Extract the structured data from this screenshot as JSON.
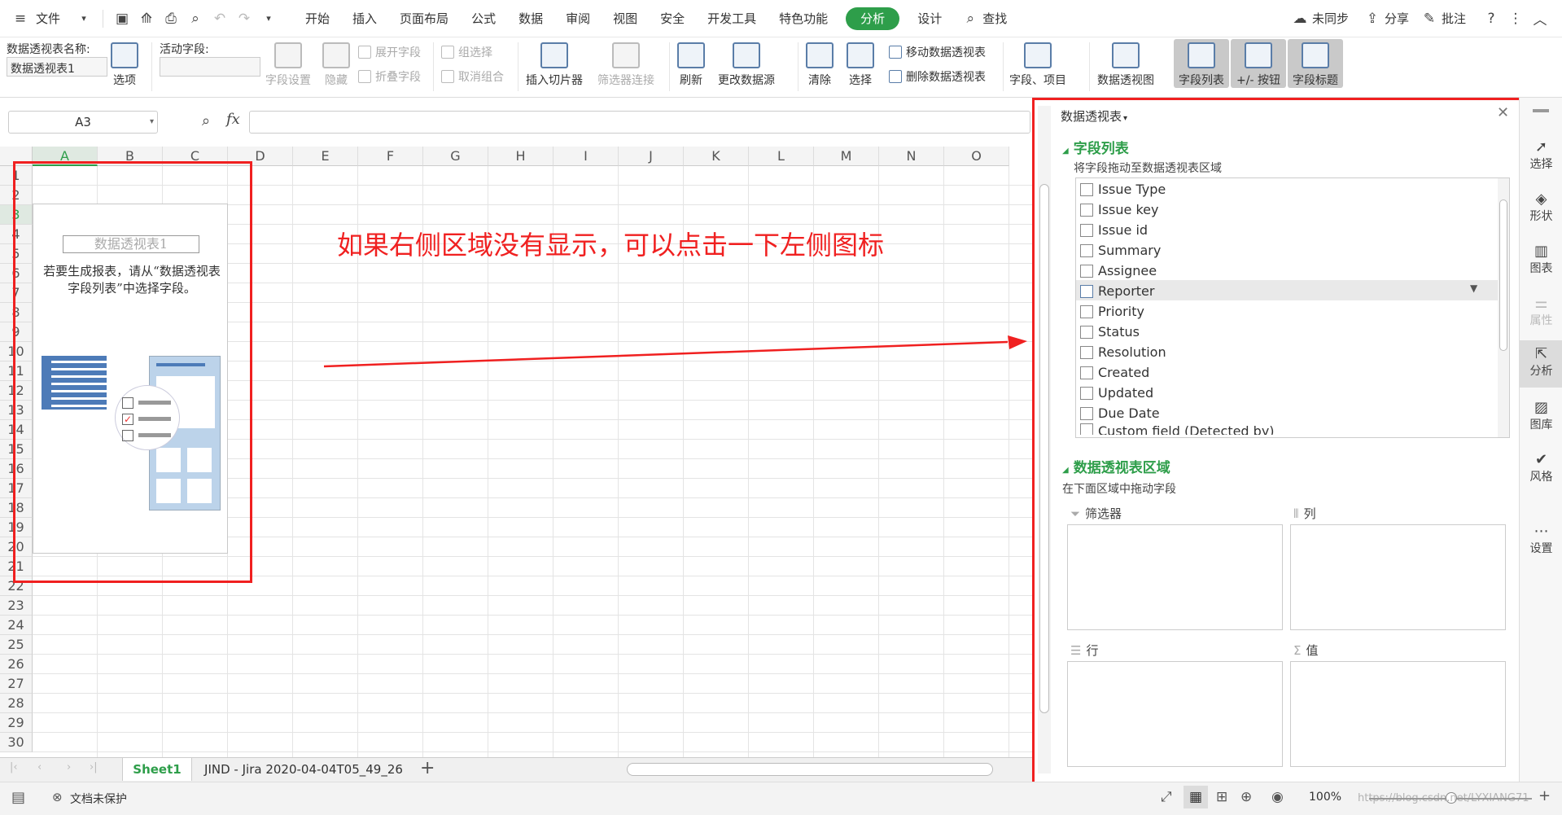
{
  "menubar": {
    "file_label": "文件",
    "menu_items": [
      "开始",
      "插入",
      "页面布局",
      "公式",
      "数据",
      "审阅",
      "视图",
      "安全",
      "开发工具",
      "特色功能",
      "分析",
      "设计"
    ],
    "active_menu": "分析",
    "search_label": "查找",
    "sync_label": "未同步",
    "share_label": "分享",
    "comment_label": "批注"
  },
  "ribbon": {
    "pivot_name_label": "数据透视表名称:",
    "pivot_name_value": "数据透视表1",
    "options_label": "选项",
    "active_field_label": "活动字段:",
    "active_field_value": "",
    "field_settings": "字段设置",
    "hide": "隐藏",
    "expand_field": "展开字段",
    "collapse_field": "折叠字段",
    "group_select": "组选择",
    "ungroup": "取消组合",
    "insert_slicer": "插入切片器",
    "filter_connect": "筛选器连接",
    "refresh": "刷新",
    "change_source": "更改数据源",
    "clear": "清除",
    "select": "选择",
    "move_pivot": "移动数据透视表",
    "delete_pivot": "删除数据透视表",
    "fields_items": "字段、项目",
    "pivot_chart": "数据透视图",
    "field_list": "字段列表",
    "plus_minus_buttons": "+/- 按钮",
    "field_headers": "字段标题"
  },
  "formula_bar": {
    "cell_ref": "A3",
    "fx_label": "fx",
    "formula": ""
  },
  "grid": {
    "columns": [
      "A",
      "B",
      "C",
      "D",
      "E",
      "F",
      "G",
      "H",
      "I",
      "J",
      "K",
      "L",
      "M",
      "N",
      "O"
    ],
    "rows": [
      "1",
      "2",
      "3",
      "4",
      "5",
      "6",
      "7",
      "8",
      "9",
      "10",
      "11",
      "12",
      "13",
      "14",
      "15",
      "16",
      "17",
      "18",
      "19",
      "20",
      "21",
      "22",
      "23",
      "24",
      "25",
      "26",
      "27",
      "28",
      "29",
      "30"
    ],
    "pivot_placeholder_title": "数据透视表1",
    "pivot_placeholder_text": "若要生成报表，请从“数据透视表字段列表”中选择字段。"
  },
  "annotation": {
    "text": "如果右侧区域没有显示，可以点击一下左侧图标",
    "color": "#f02020"
  },
  "sheet_tabs": {
    "tabs": [
      "Sheet1",
      "JIND - Jira 2020-04-04T05_49_26"
    ],
    "active_tab": "Sheet1",
    "add_label": "+"
  },
  "status_bar": {
    "doc_protect": "文档未保护",
    "zoom": "100%",
    "watermark": "https://blog.csdn.net/LYXIANG71"
  },
  "panel": {
    "title": "数据透视表",
    "field_list_heading": "字段列表",
    "field_list_hint": "将字段拖动至数据透视表区域",
    "fields": [
      "Issue Type",
      "Issue key",
      "Issue id",
      "Summary",
      "Assignee",
      "Reporter",
      "Priority",
      "Status",
      "Resolution",
      "Created",
      "Updated",
      "Due Date",
      "Custom field (Detected by)"
    ],
    "hovered_field": "Reporter",
    "areas_heading": "数据透视表区域",
    "areas_hint": "在下面区域中拖动字段",
    "filter_label": "筛选器",
    "column_label": "列",
    "row_label": "行",
    "value_label": "值"
  },
  "sidebar": {
    "items": [
      "选择",
      "形状",
      "图表",
      "属性",
      "分析",
      "图库",
      "风格",
      "设置"
    ],
    "selected": "分析",
    "disabled": [
      "属性"
    ]
  }
}
